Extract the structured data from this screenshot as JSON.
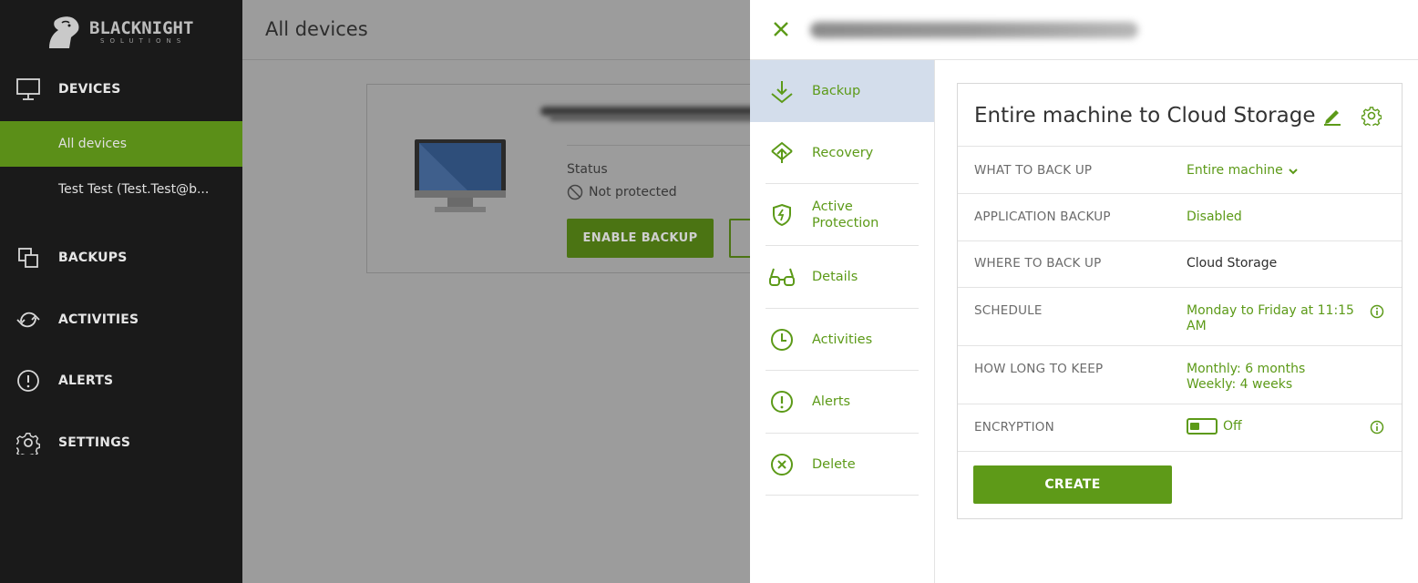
{
  "brand": {
    "name": "BLACKNIGHT",
    "sub": "SOLUTIONS"
  },
  "sidebar": {
    "sections": [
      {
        "label": "DEVICES",
        "icon": "monitor-icon"
      },
      {
        "label": "BACKUPS",
        "icon": "copy-icon"
      },
      {
        "label": "ACTIVITIES",
        "icon": "sync-icon"
      },
      {
        "label": "ALERTS",
        "icon": "alert-icon"
      },
      {
        "label": "SETTINGS",
        "icon": "gear-icon"
      }
    ],
    "sub_items": [
      {
        "label": "All devices",
        "active": true
      },
      {
        "label": "Test Test (Test.Test@b...",
        "active": false
      }
    ]
  },
  "main": {
    "title": "All devices",
    "device": {
      "status_label": "Status",
      "status_value": "Not protected",
      "enable_button": "ENABLE BACKUP"
    }
  },
  "panel": {
    "menu": [
      {
        "label": "Backup",
        "icon": "download-icon",
        "active": true
      },
      {
        "label": "Recovery",
        "icon": "upload-icon",
        "active": false
      },
      {
        "label": "Active Protection",
        "icon": "shield-icon",
        "active": false
      },
      {
        "label": "Details",
        "icon": "glasses-icon",
        "active": false
      },
      {
        "label": "Activities",
        "icon": "clock-icon",
        "active": false
      },
      {
        "label": "Alerts",
        "icon": "alert-icon",
        "active": false
      },
      {
        "label": "Delete",
        "icon": "close-circle-icon",
        "active": false
      }
    ],
    "plan": {
      "title": "Entire machine to Cloud Storage",
      "rows": [
        {
          "label": "WHAT TO BACK UP",
          "value": "Entire machine",
          "dropdown": true
        },
        {
          "label": "APPLICATION BACKUP",
          "value": "Disabled"
        },
        {
          "label": "WHERE TO BACK UP",
          "value": "Cloud Storage"
        },
        {
          "label": "SCHEDULE",
          "value": "Monday to Friday at 11:15 AM",
          "info": true
        },
        {
          "label": "HOW LONG TO KEEP",
          "value_line1": "Monthly: 6 months",
          "value_line2": "Weekly: 4 weeks"
        },
        {
          "label": "ENCRYPTION",
          "value": "Off",
          "toggle": false,
          "info": true
        }
      ],
      "create_button": "CREATE"
    }
  },
  "colors": {
    "accent": "#5c9a18",
    "sidebar_bg": "#1a1a1a",
    "active_nav": "#5b8f18",
    "overlay_bg": "#9c9c9c",
    "menu_active": "#d3ddeb"
  }
}
